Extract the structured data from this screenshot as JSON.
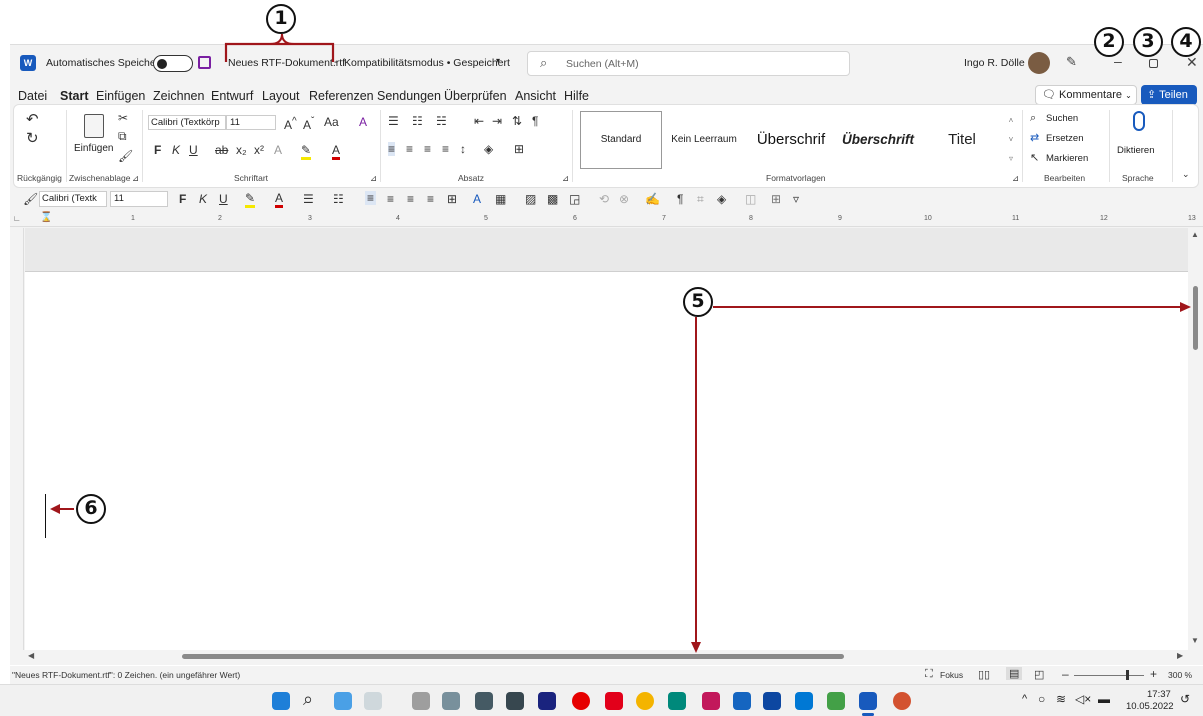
{
  "callouts": [
    "1",
    "2",
    "3",
    "4",
    "5",
    "6"
  ],
  "titlebar": {
    "autosave_label": "Automatisches Speichern",
    "doc_name": "Neues RTF-Dokument.rtf",
    "separator": "-",
    "doc_status": "Kompatibilitätsmodus • Gespeichert",
    "search_placeholder": "Suchen (Alt+M)",
    "user_name": "Ingo R. Dölle"
  },
  "menu": {
    "items": [
      "Datei",
      "Start",
      "Einfügen",
      "Zeichnen",
      "Entwurf",
      "Layout",
      "Referenzen",
      "Sendungen",
      "Überprüfen",
      "Ansicht",
      "Hilfe"
    ],
    "comments_label": "Kommentare",
    "share_label": "Teilen"
  },
  "ribbon": {
    "undo_group": "Rückgängig",
    "clipboard_group": "Zwischenablage",
    "paste_label": "Einfügen",
    "font_name": "Calibri (Textkörp",
    "font_size": "11",
    "font_group": "Schriftart",
    "paragraph_group": "Absatz",
    "styles": [
      "Standard",
      "Kein Leerraum",
      "Überschrif",
      "Überschrift",
      "Titel"
    ],
    "styles_group": "Formatvorlagen",
    "search_label": "Suchen",
    "replace_label": "Ersetzen",
    "select_label": "Markieren",
    "edit_group": "Bearbeiten",
    "dictate_label": "Diktieren",
    "voice_group": "Sprache"
  },
  "qat": {
    "font_name": "Calibri (Textk",
    "font_size": "11"
  },
  "ruler": {
    "marks": [
      "1",
      "2",
      "3",
      "4",
      "5",
      "6",
      "7",
      "8",
      "9",
      "10",
      "11",
      "12",
      "13"
    ]
  },
  "status": {
    "text": "\"Neues RTF-Dokument.rtf\": 0 Zeichen. (ein ungefährer Wert)",
    "focus": "Fokus",
    "zoom": "300 %"
  },
  "taskbar": {
    "time": "17:37",
    "date": "10.05.2022"
  },
  "colors": {
    "word_blue": "#185abd",
    "accent": "#1a73e8",
    "callout_arrow": "#a0161b"
  }
}
